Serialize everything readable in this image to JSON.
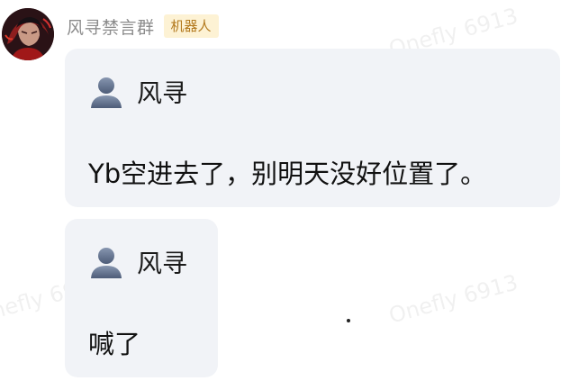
{
  "header": {
    "sender_name": "风寻禁言群",
    "badge_label": "机器人"
  },
  "messages": [
    {
      "quoted_user": "风寻",
      "text": "Yb空进去了，别明天没好位置了。"
    },
    {
      "quoted_user": "风寻",
      "text": "喊了"
    }
  ],
  "watermark": "Onefly 6913",
  "icons": {
    "avatar": "avatar-image",
    "user": "user-silhouette-icon"
  },
  "colors": {
    "bubble_bg": "#f1f3f7",
    "badge_bg": "#fdf2d4",
    "badge_text": "#b37a1f",
    "sender_name": "#8c8c8c",
    "user_icon": "#5d6d88"
  }
}
